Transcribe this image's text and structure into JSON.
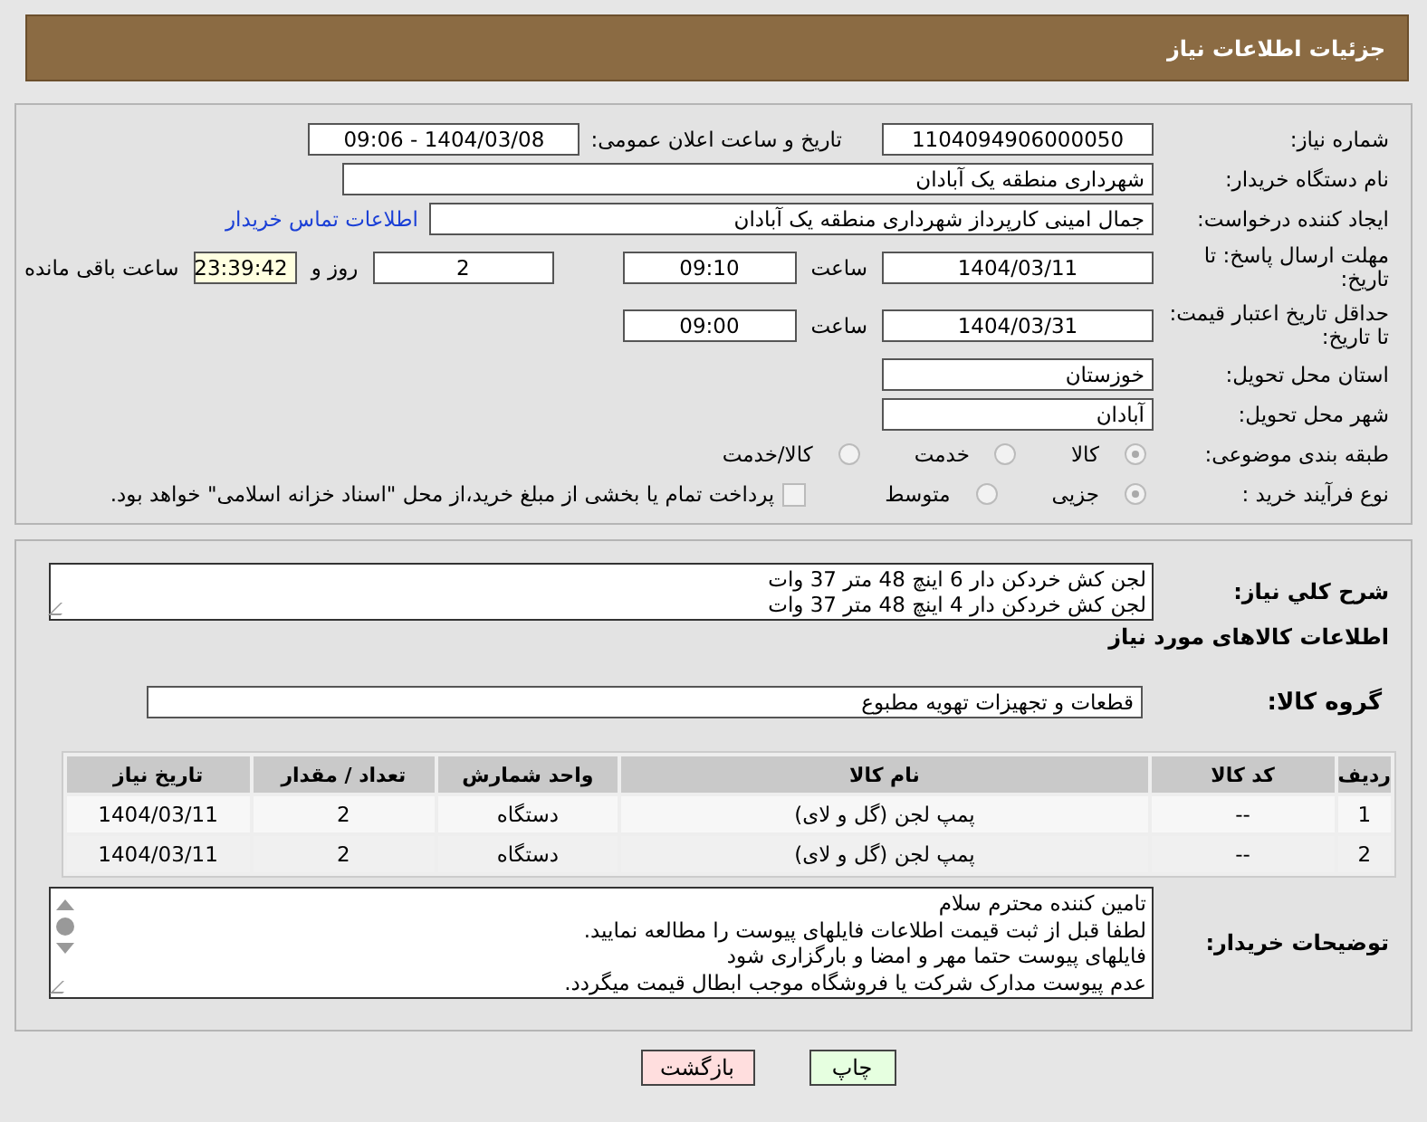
{
  "header": {
    "title": "جزئیات اطلاعات نیاز"
  },
  "need_number": {
    "label": "شماره نیاز:",
    "value": "1104094906000050"
  },
  "announce": {
    "label": "تاریخ و ساعت اعلان عمومی:",
    "value": "1404/03/08 - 09:06"
  },
  "buyer_org": {
    "label": "نام دستگاه خریدار:",
    "value": "شهرداری منطقه یک آبادان"
  },
  "requester": {
    "label": "ایجاد کننده درخواست:",
    "value": "جمال امینی کارپرداز شهرداری منطقه یک آبادان",
    "link": "اطلاعات تماس خریدار"
  },
  "reply_deadline": {
    "label": "مهلت ارسال پاسخ: تا تاریخ:",
    "date": "1404/03/11",
    "time_label": "ساعت",
    "time": "09:10",
    "days": "2",
    "days_label": "روز و",
    "remaining": "23:39:42",
    "remaining_label": "ساعت باقی مانده"
  },
  "price_validity": {
    "label": "حداقل تاریخ اعتبار قیمت: تا تاریخ:",
    "date": "1404/03/31",
    "time_label": "ساعت",
    "time": "09:00"
  },
  "province": {
    "label": "استان محل تحویل:",
    "value": "خوزستان"
  },
  "city": {
    "label": "شهر محل تحویل:",
    "value": "آبادان"
  },
  "category": {
    "label": "طبقه بندی موضوعی:",
    "options": [
      {
        "label": "کالا",
        "selected": true
      },
      {
        "label": "خدمت",
        "selected": false
      },
      {
        "label": "کالا/خدمت",
        "selected": false
      }
    ]
  },
  "purchase_type": {
    "label": "نوع فرآیند خرید :",
    "options": [
      {
        "label": "جزیی",
        "selected": true
      },
      {
        "label": "متوسط",
        "selected": false
      }
    ],
    "payment": {
      "label": "پرداخت تمام یا بخشی از مبلغ خرید،از محل \"اسناد خزانه اسلامی\" خواهد بود.",
      "checked": false
    }
  },
  "summary": {
    "label": "شرح کلي نياز:",
    "lines": [
      "لجن کش خردکن دار 6 اینچ 48 متر 37 وات",
      "لجن کش خردکن دار 4 اینچ 48 متر 37 وات"
    ]
  },
  "goods_heading": "اطلاعات کالاهای مورد نیاز",
  "goods_group": {
    "label": "گروه کالا:",
    "value": "قطعات و تجهیزات تهویه مطبوع"
  },
  "table": {
    "columns": [
      "ردیف",
      "کد کالا",
      "نام کالا",
      "واحد شمارش",
      "تعداد / مقدار",
      "تاریخ نیاز"
    ],
    "rows": [
      [
        "1",
        "--",
        "پمپ لجن (گل و لای)",
        "دستگاه",
        "2",
        "1404/03/11"
      ],
      [
        "2",
        "--",
        "پمپ لجن (گل و لای)",
        "دستگاه",
        "2",
        "1404/03/11"
      ]
    ]
  },
  "buyer_notes": {
    "label": "توضیحات خریدار:",
    "lines": [
      "تامین کننده محترم سلام",
      "لطفا قبل از ثبت قیمت اطلاعات فایلهای پیوست را مطالعه نمایید.",
      "فایلهای پیوست حتما مهر و امضا و بارگزاری شود",
      "عدم پیوست مدارک شرکت یا فروشگاه موجب ابطال قیمت میگردد."
    ]
  },
  "buttons": [
    {
      "label": "چاپ",
      "kind": "print"
    },
    {
      "label": "بازگشت",
      "kind": "back"
    }
  ]
}
